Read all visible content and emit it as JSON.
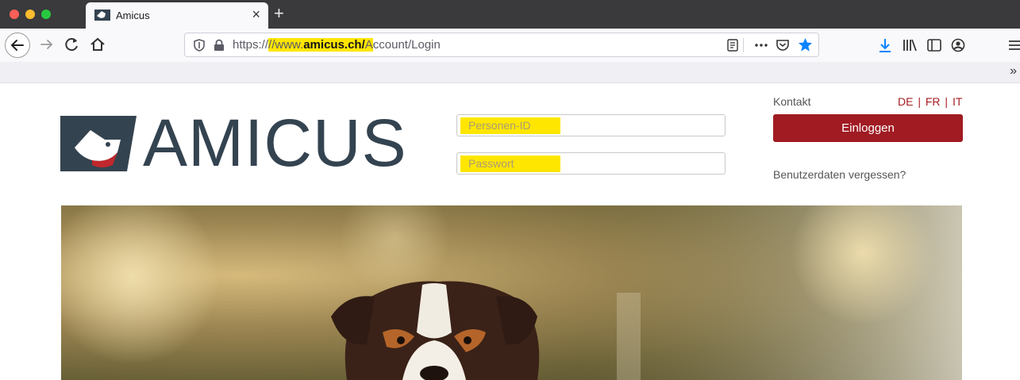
{
  "browser": {
    "tab_title": "Amicus",
    "tab_close": "×",
    "new_tab": "+",
    "url": {
      "prefix": "https://",
      "highlight_before": "//www.",
      "domain": "amicus.ch/",
      "highlight_after": "A",
      "rest": "ccount/Login",
      "full": "https://www.amicus.ch/Account/Login"
    },
    "bookmarks_more": "»"
  },
  "page": {
    "logo_text": "AMICUS",
    "contact_label": "Kontakt",
    "languages": "DE | FR | IT",
    "person_id_placeholder": "Personen-ID",
    "password_placeholder": "Passwort",
    "login_label": "Einloggen",
    "forgot_label": "Benutzerdaten vergessen?"
  },
  "colors": {
    "brand_dark": "#344350",
    "accent_red": "#a01b22",
    "highlight": "#ffe600"
  }
}
